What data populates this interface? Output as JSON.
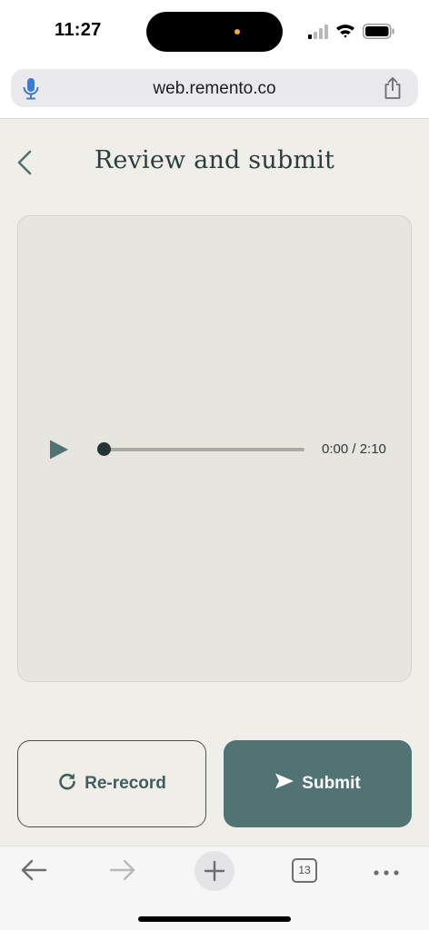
{
  "status_bar": {
    "time": "11:27"
  },
  "browser": {
    "url": "web.remento.co",
    "tab_count": "13"
  },
  "page": {
    "title": "Review and submit",
    "player": {
      "time_readout": "0:00 / 2:10",
      "progress": 0.0
    },
    "buttons": {
      "rerecord_label": "Re-record",
      "submit_label": "Submit"
    }
  },
  "colors": {
    "page_background": "#f0eee9",
    "accent": "#517373",
    "title_text": "#2c3d3b"
  },
  "icons": [
    "mic-icon",
    "share-icon",
    "chevron-left-icon",
    "play-icon",
    "refresh-icon",
    "send-icon",
    "arrow-left-icon",
    "arrow-right-icon",
    "plus-icon",
    "more-icon"
  ]
}
